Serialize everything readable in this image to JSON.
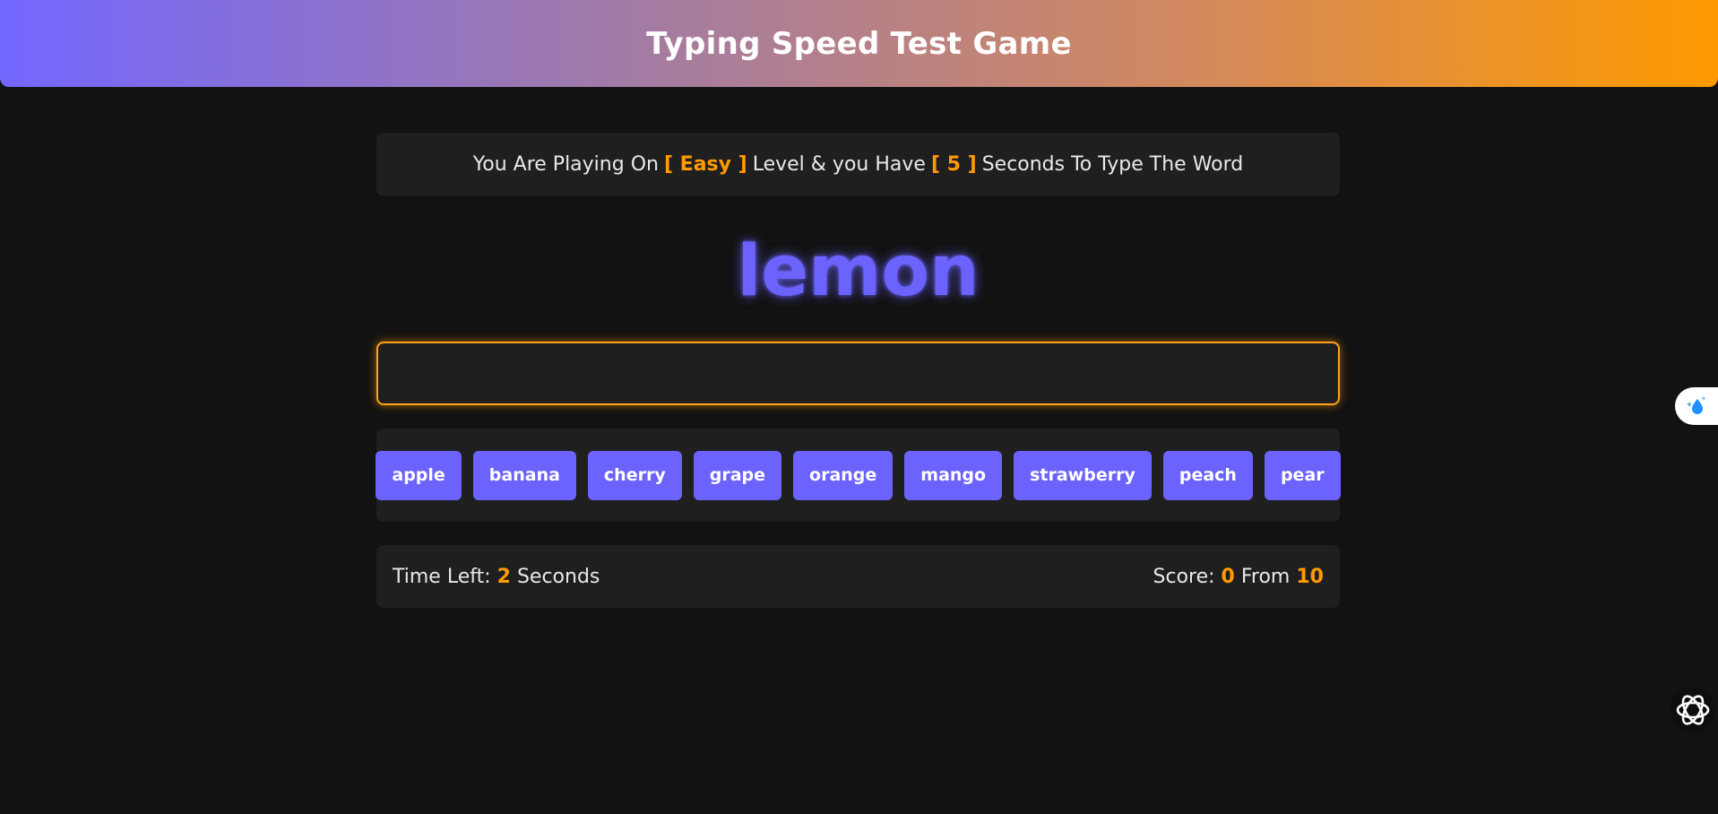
{
  "header": {
    "title": "Typing Speed Test Game"
  },
  "message": {
    "prefix": "You Are Playing On",
    "level": "[ Easy ]",
    "middle": "Level & you Have",
    "seconds": "[ 5 ]",
    "suffix": "Seconds To Type The Word"
  },
  "current_word": "lemon",
  "input": {
    "value": "",
    "placeholder": ""
  },
  "upcoming_words": [
    "apple",
    "banana",
    "cherry",
    "grape",
    "orange",
    "mango",
    "strawberry",
    "peach",
    "pear"
  ],
  "control": {
    "time_label": "Time Left:",
    "time_value": "2",
    "time_unit": "Seconds",
    "score_label": "Score:",
    "score_value": "0",
    "score_from_label": "From",
    "score_total": "10"
  },
  "icons": {
    "side_tool": "water-drop-sparkle-icon",
    "assistant": "openai-logo-icon"
  },
  "colors": {
    "accent_purple": "#6c63ff",
    "accent_orange": "#ff9a00",
    "background": "#121212",
    "panel": "#1f1f1f"
  }
}
